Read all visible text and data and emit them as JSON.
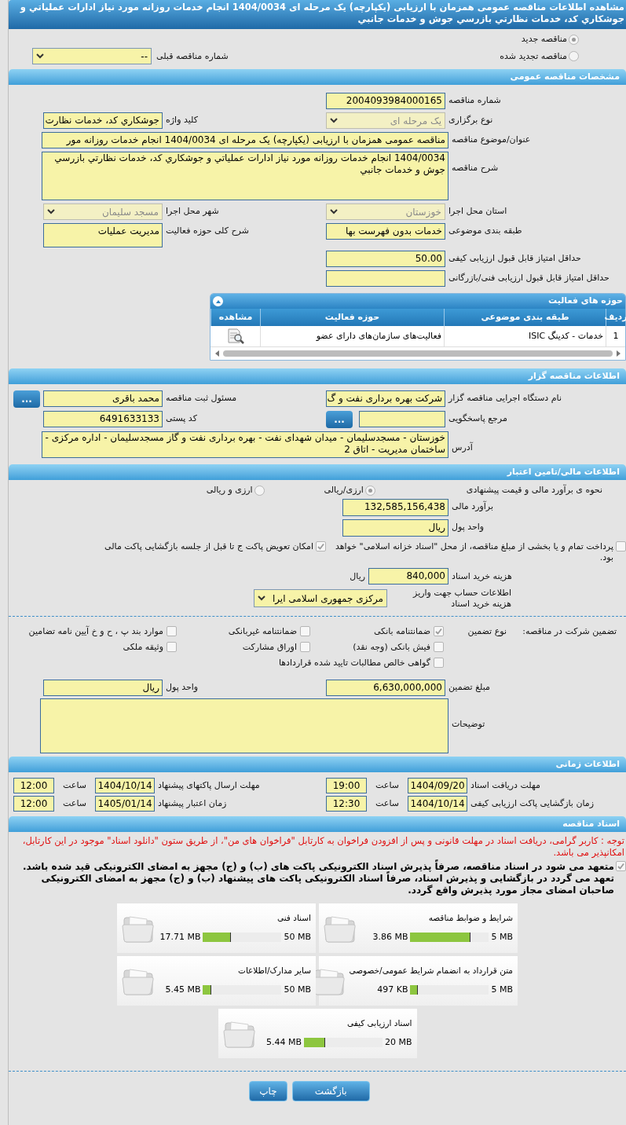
{
  "title": "مشاهده اطلاعات مناقصه عمومی همزمان با ارزیابی (یکپارچه) یک مرحله ای 1404/0034 انجام خدمات روزانه مورد نیاز ادارات عملیاتي و جوشکاري کد، خدمات نظارتي بازرسي جوش و خدمات جانبي",
  "tender_status": {
    "options": [
      {
        "label": "مناقصه جدید",
        "selected": true
      },
      {
        "label": "مناقصه تجدید شده",
        "selected": false
      }
    ],
    "previous": {
      "label": "شماره مناقصه قبلی",
      "kind": "select",
      "value": "--",
      "disabled": false
    }
  },
  "general": {
    "title": "مشخصات مناقصه عمومی",
    "rows": [
      [
        {
          "label": "شماره مناقصه",
          "kind": "input",
          "value": "2004093984000165"
        }
      ],
      [
        {
          "label": "نوع برگزاری",
          "kind": "select",
          "value": "یک مرحله ای",
          "disabled": true
        },
        {
          "label": "کلید واژه",
          "kind": "input",
          "value": "جوشکاري کد، خدمات نظارت"
        }
      ],
      [
        {
          "label": "عنوان/موضوع مناقصه",
          "kind": "long_input",
          "value": "مناقصه عمومی همزمان با ارزیابی (یکپارچه) یک مرحله ای 1404/0034 انجام خدمات روزانه مور"
        }
      ],
      [
        {
          "label": "شرح مناقصه",
          "kind": "textarea",
          "value": "1404/0034 انجام خدمات روزانه مورد نیاز ادارات عملیاتي و جوشکاري کد، خدمات نظارتي بازرسي جوش و خدمات جانبي"
        }
      ],
      [
        {
          "label": "استان محل اجرا",
          "kind": "select",
          "value": "خوزستان",
          "disabled": true
        },
        {
          "label": "شهر محل اجرا",
          "kind": "select",
          "value": "مسجد سلیمان",
          "disabled": true
        }
      ],
      [
        {
          "label": "طبقه بندی موضوعی",
          "kind": "input",
          "value": "خدمات بدون فهرست بها"
        },
        {
          "label": "شرح کلی حوزه فعالیت",
          "kind": "box",
          "value": "مدیریت عملیات"
        }
      ],
      [
        {
          "label": "حداقل امتیاز قابل قبول ارزیابی کیفی",
          "kind": "input",
          "value": "50.00"
        }
      ],
      [
        {
          "label": "حداقل امتیاز قابل قبول ارزیابی فنی/بازرگانی",
          "kind": "input"
        }
      ]
    ],
    "activities": {
      "title": "حوزه های فعالیت",
      "expanded": true,
      "columns": [
        "ردیف",
        "طبقه بندی موضوعی",
        "حوزه فعالیت",
        "مشاهده"
      ],
      "rows": [
        [
          "1",
          "خدمات - کدینگ ISIC",
          "فعالیت‌های سازمان‌های دارای عضو"
        ]
      ]
    }
  },
  "organizer": {
    "title": "اطلاعات مناقصه گزار",
    "rows": [
      [
        {
          "label": "نام دستگاه اجرایی مناقصه گزار",
          "kind": "input",
          "value": "شرکت بهره برداری نفت و گ"
        },
        {
          "label": "مسئول ثبت مناقصه",
          "kind": "input",
          "value": "محمد باقری",
          "button": "..."
        }
      ],
      [
        {
          "label": "مرجع پاسخگویی",
          "kind": "input",
          "button": "..."
        },
        {
          "label": "کد پستی",
          "kind": "input",
          "value": "6491633133"
        }
      ],
      [
        {
          "label": "آدرس",
          "kind": "textarea",
          "value": "خوزستان - مسجدسلیمان - میدان شهدای نفت - بهره برداری نفت و گاز مسجدسلیمان - اداره مرکزی - ساختمان مدیریت - اتاق 2"
        }
      ]
    ]
  },
  "finance": {
    "title": "اطلاعات مالی/تامین اعتبار",
    "estimate_method": {
      "label": "نحوه ی برآورد مالی و قیمت پیشنهادی",
      "options": [
        {
          "label": "ارزی/ریالی",
          "selected": true
        },
        {
          "label": "ارزی و ریالی",
          "selected": false
        }
      ]
    },
    "estimate": {
      "label": "برآورد مالی",
      "value": "132,585,156,438"
    },
    "currency": {
      "label": "واحد پول",
      "value": "ریال"
    },
    "options": [
      {
        "label": "پرداخت تمام و یا بخشی از مبلغ مناقصه، از محل \"اسناد خزانه اسلامی\" خواهد بود.",
        "checked": false
      },
      {
        "label": "امکان تعویض پاکت ج تا قبل از جلسه بازگشایی پاکت مالی",
        "checked": true
      }
    ],
    "document_fee": {
      "label": "هزینه خرید اسناد",
      "value": "840,000",
      "unit": "ریال"
    },
    "account": {
      "label": "اطلاعات حساب جهت واریز هزینه خرید اسناد",
      "kind": "select",
      "value": "مرکزی جمهوری اسلامی ایرا",
      "disabled": false
    },
    "guarantee": {
      "label": "تضمین شرکت در مناقصه:",
      "type_label": "نوع تضمین",
      "types": [
        {
          "label": "ضمانتنامه بانکی",
          "checked": true
        },
        {
          "label": "ضمانتنامه غیربانکی",
          "checked": false
        },
        {
          "label": "موارد بند پ ، ح و خ آیین نامه تضامین",
          "checked": false
        },
        {
          "label": "فیش بانکی (وجه نقد)",
          "checked": false
        },
        {
          "label": "اوراق مشارکت",
          "checked": false
        },
        {
          "label": "وثیقه ملکی",
          "checked": false
        },
        {
          "label": "گواهی خالص مطالبات تایید شده قراردادها",
          "checked": false
        }
      ]
    },
    "guarantee_amount": {
      "label": "مبلغ تضمین",
      "value": "6,630,000,000"
    },
    "guarantee_currency": {
      "label": "واحد پول",
      "value": "ریال"
    },
    "notes": {
      "label": "توضیحات"
    }
  },
  "schedule": {
    "title": "اطلاعات زمانی",
    "items": [
      {
        "label": "مهلت دریافت اسناد",
        "date": "1404/09/20",
        "time_label": "ساعت",
        "time": "19:00"
      },
      {
        "label": "مهلت ارسال پاکتهای پیشنهاد",
        "date": "1404/10/14",
        "time_label": "ساعت",
        "time": "12:00"
      },
      {
        "label": "زمان بازگشایی پاکت ارزیابی کیفی",
        "date": "1404/10/14",
        "time_label": "ساعت",
        "time": "12:30"
      },
      {
        "label": "زمان اعتبار پیشنهاد",
        "date": "1405/01/14",
        "time_label": "ساعت",
        "time": "12:00"
      }
    ]
  },
  "documents": {
    "title": "اسناد مناقصه",
    "notice": "توجه : کاربر گرامی، دریافت اسناد در مهلت قانونی و پس از افزودن فراخوان به کارتابل \"فراخوان های من\"، از طریق ستون \"دانلود اسناد\" موجود در این کارتابل، امکانپذیر می باشد.",
    "commitment": {
      "text": "متعهد می شود در اسناد مناقصه، صرفاً پذیرش اسناد الکترونیکی پاکت های (ب) و (ج) مجهز به امضای الکترونیکی قید شده باشد. تعهد می گردد در بازگشایی و پذیرش اسناد، صرفاً اسناد الکترونیکی پاکت های پیشنهاد (ب) و (ج) مجهز به امضای الکترونیکی صاحبان امضای مجاز مورد پذیرش واقع گردد.",
      "checked": true
    },
    "files": [
      {
        "title": "شرایط و ضوابط مناقصه",
        "max": "5 MB",
        "used": "3.86 MB",
        "level": 0.77
      },
      {
        "title": "اسناد فنی",
        "max": "50 MB",
        "used": "17.71 MB",
        "level": 0.354
      },
      {
        "title": "متن قرارداد به انضمام شرایط عمومی/خصوصی",
        "max": "5 MB",
        "used": "497 KB",
        "level": 0.1
      },
      {
        "title": "سایر مدارک/اطلاعات",
        "max": "50 MB",
        "used": "5.45 MB",
        "level": 0.109
      },
      {
        "title": "اسناد ارزیابی کیفی",
        "max": "20 MB",
        "used": "5.44 MB",
        "level": 0.272
      }
    ]
  },
  "buttons": [
    "بازگشت",
    "چاپ"
  ]
}
